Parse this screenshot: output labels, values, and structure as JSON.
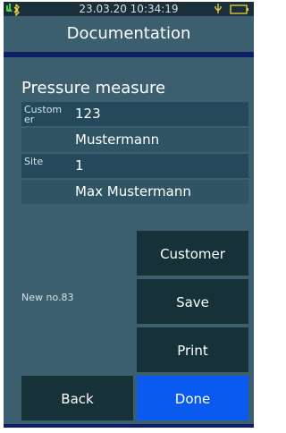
{
  "statusbar": {
    "datetime": "23.03.20 10:34:19",
    "icons": [
      "signal-icon",
      "bluetooth-icon",
      "usb-icon",
      "battery-icon"
    ]
  },
  "header": {
    "title": "Documentation"
  },
  "section": {
    "title": "Pressure measure"
  },
  "rows": [
    {
      "label": "Custom er",
      "value": "123"
    },
    {
      "label": "",
      "value": "Mustermann"
    },
    {
      "label": "Site",
      "value": "1"
    },
    {
      "label": "",
      "value": "Max Mustermann"
    }
  ],
  "new_no": "New no.83",
  "buttons": {
    "customer": "Customer",
    "save": "Save",
    "print": "Print",
    "back": "Back",
    "done": "Done"
  },
  "colors": {
    "background": "#3b5f6e",
    "statusbar": "#1b2f3a",
    "accent_line": "#0e1f66",
    "button": "#163238",
    "done_button": "#0a5af0",
    "status_icon_green": "#4fd14f",
    "status_icon_yellow": "#e8d437"
  }
}
